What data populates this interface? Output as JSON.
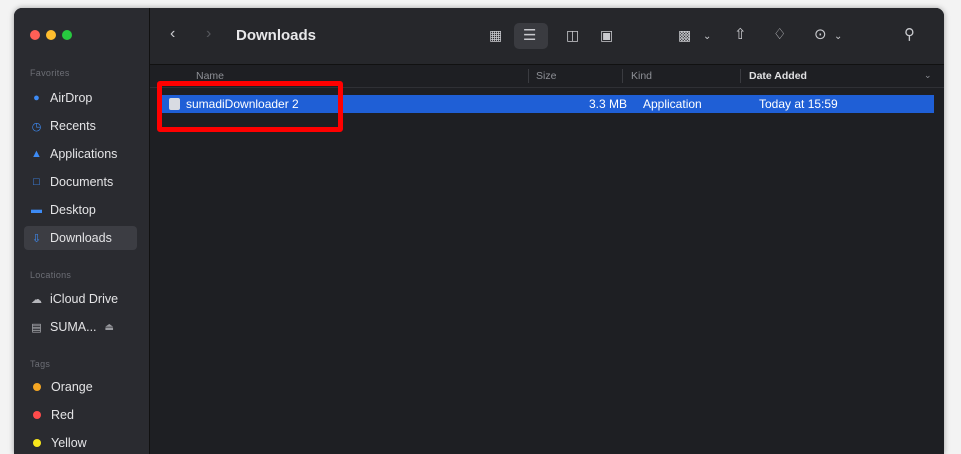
{
  "window": {
    "title": "Downloads"
  },
  "sidebar": {
    "favorites_label": "Favorites",
    "favorites": [
      {
        "label": "AirDrop",
        "icon": "airdrop-icon"
      },
      {
        "label": "Recents",
        "icon": "clock-icon"
      },
      {
        "label": "Applications",
        "icon": "applications-icon"
      },
      {
        "label": "Documents",
        "icon": "document-icon"
      },
      {
        "label": "Desktop",
        "icon": "desktop-icon"
      },
      {
        "label": "Downloads",
        "icon": "download-icon",
        "active": true
      }
    ],
    "locations_label": "Locations",
    "locations": [
      {
        "label": "iCloud Drive",
        "icon": "cloud-icon"
      },
      {
        "label": "SUMA...",
        "icon": "disk-icon"
      }
    ],
    "tags_label": "Tags",
    "tags": [
      {
        "label": "Orange",
        "color": "#f5a623"
      },
      {
        "label": "Red",
        "color": "#ff4b4b"
      },
      {
        "label": "Yellow",
        "color": "#f8e71c"
      }
    ]
  },
  "columns": {
    "name": "Name",
    "size": "Size",
    "kind": "Kind",
    "date_added": "Date Added"
  },
  "files": [
    {
      "name": "sumadiDownloader 2",
      "size": "3.3 MB",
      "kind": "Application",
      "date_added": "Today at 15:59"
    }
  ],
  "colors": {
    "selection": "#1f5fd6",
    "highlight_box": "#ff0000"
  }
}
